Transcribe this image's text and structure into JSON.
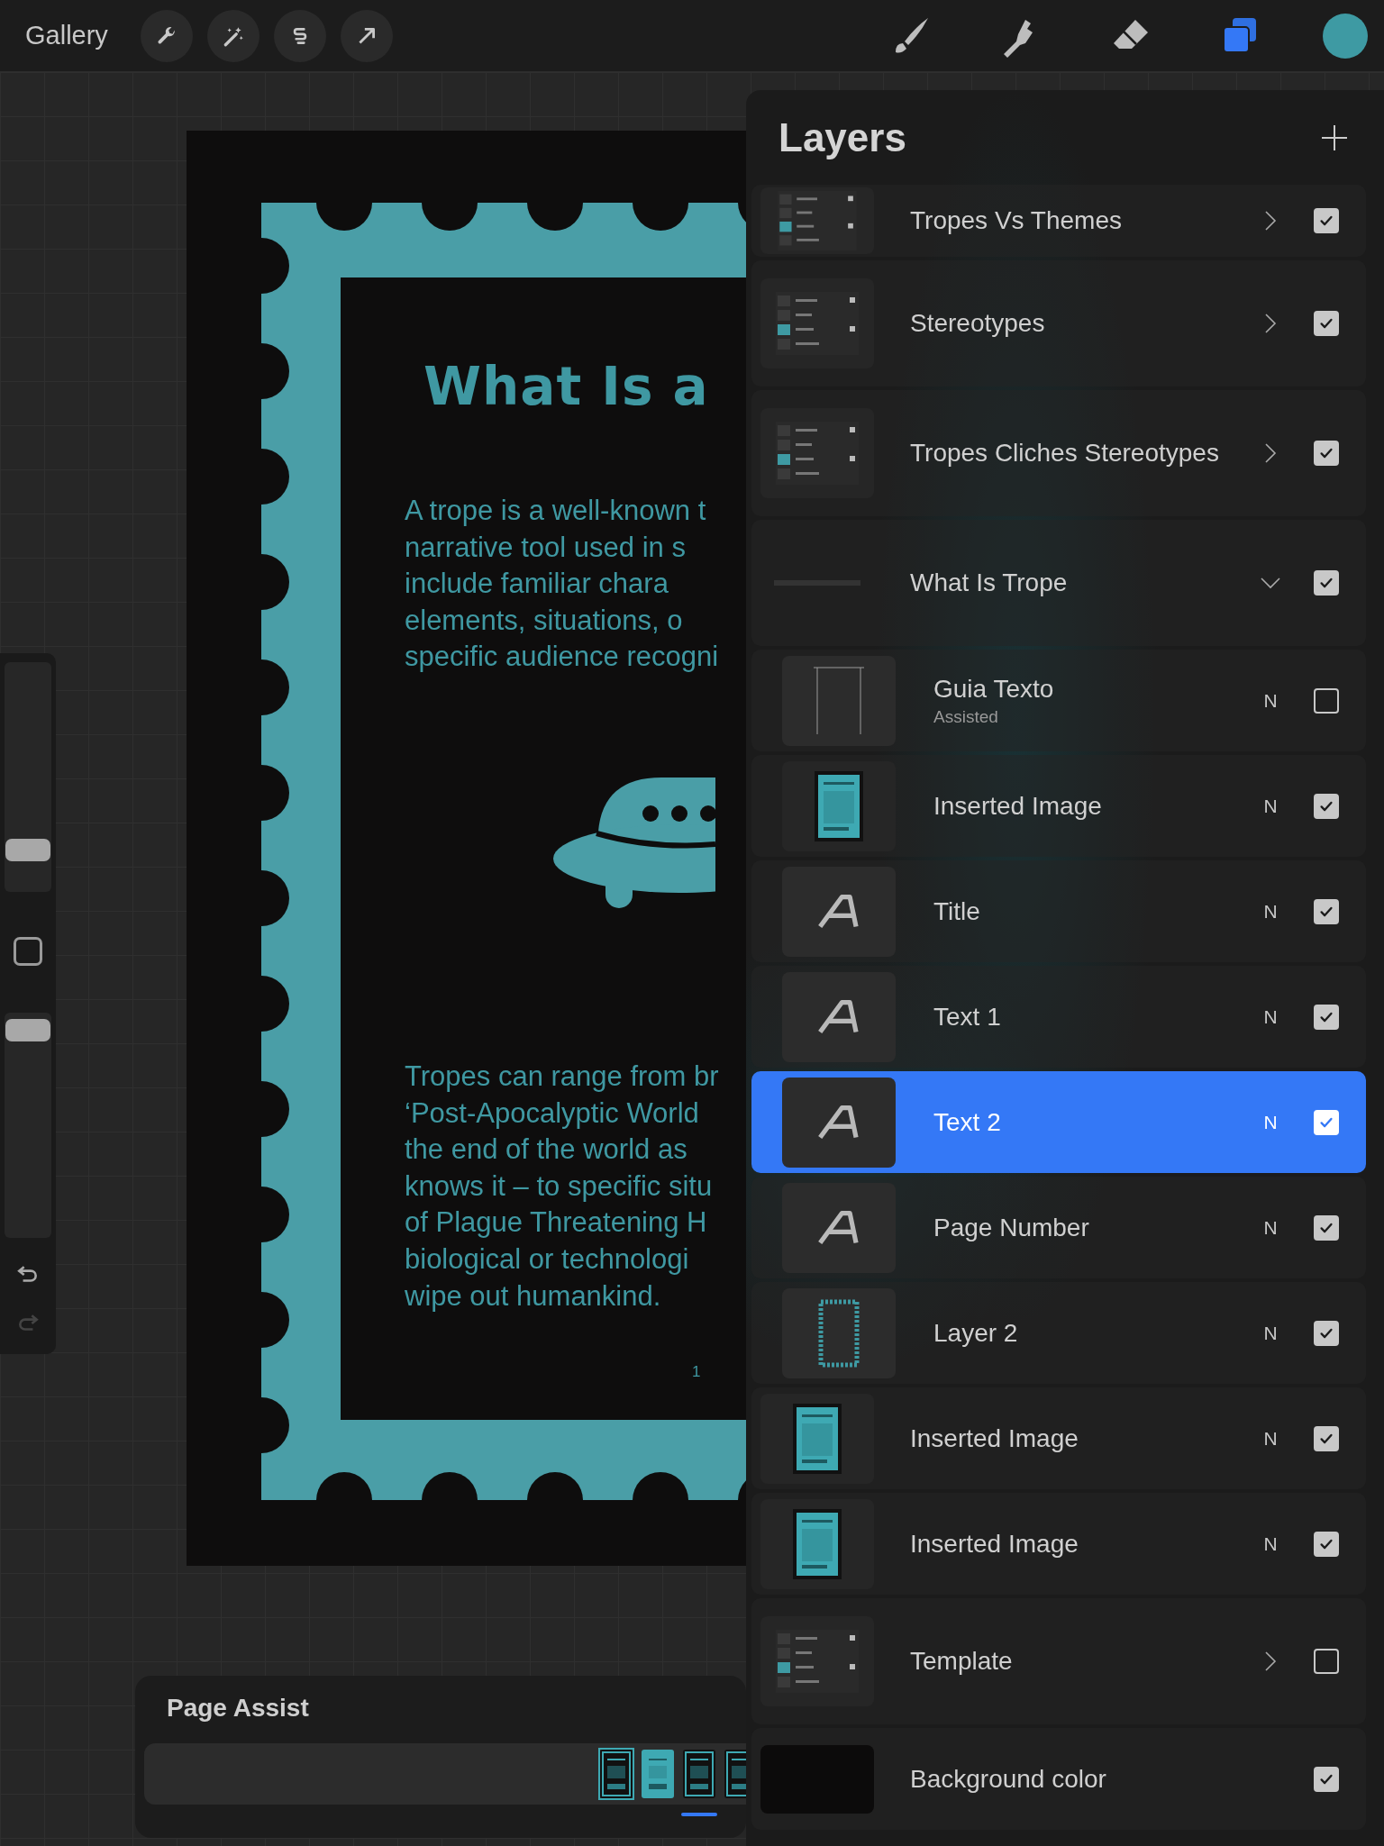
{
  "toolbar": {
    "gallery": "Gallery"
  },
  "document": {
    "title": "What Is a",
    "paragraph_1": [
      "A trope is a well-known t",
      "narrative tool used in s",
      "include familiar chara",
      "elements, situations, o",
      "specific audience recogni"
    ],
    "paragraph_2": [
      "Tropes can range from br",
      "‘Post-Apocalyptic World",
      "the end of the world as",
      "knows it – to specific situ",
      "of Plague Threatening H",
      "biological or technologi",
      "wipe out humankind."
    ],
    "page_number": "1"
  },
  "sidebar": {
    "brush_size": {
      "level": 0.18
    },
    "opacity": {
      "level": 0.92
    }
  },
  "page_assist": {
    "title": "Page Assist",
    "pages": [
      {
        "selected": false
      },
      {
        "selected": false
      },
      {
        "selected": true
      },
      {
        "selected": false
      }
    ]
  },
  "layers": {
    "title": "Layers",
    "items": [
      {
        "name": "Tropes Vs Themes",
        "kind": "group",
        "expanded": false,
        "checked": true,
        "selected": false
      },
      {
        "name": "Stereotypes",
        "kind": "group",
        "expanded": false,
        "checked": true,
        "selected": false
      },
      {
        "name": "Tropes Cliches Stereotypes",
        "kind": "group",
        "expanded": false,
        "checked": true,
        "selected": false
      },
      {
        "name": "What Is Trope",
        "kind": "group",
        "expanded": true,
        "checked": true,
        "selected": false,
        "children": [
          {
            "name": "Guia Texto",
            "subtitle": "Assisted",
            "kind": "guide",
            "blend": "N",
            "checked": false,
            "selected": false
          },
          {
            "name": "Inserted Image",
            "blend": "N",
            "checked": true,
            "selected": false
          },
          {
            "name": "Title",
            "kind": "text",
            "blend": "N",
            "checked": true,
            "selected": false
          },
          {
            "name": "Text 1",
            "kind": "text",
            "blend": "N",
            "checked": true,
            "selected": false
          },
          {
            "name": "Text 2",
            "kind": "text",
            "blend": "N",
            "checked": true,
            "selected": true
          },
          {
            "name": "Page Number",
            "kind": "text",
            "blend": "N",
            "checked": true,
            "selected": false
          },
          {
            "name": "Layer 2",
            "kind": "frame",
            "blend": "N",
            "checked": true,
            "selected": false
          }
        ]
      },
      {
        "name": "Inserted Image",
        "blend": "N",
        "checked": true,
        "selected": false
      },
      {
        "name": "Inserted Image",
        "blend": "N",
        "checked": true,
        "selected": false
      },
      {
        "name": "Template",
        "kind": "group",
        "expanded": false,
        "checked": false,
        "selected": false
      },
      {
        "name": "Background color",
        "kind": "background",
        "checked": true,
        "selected": false
      }
    ]
  }
}
